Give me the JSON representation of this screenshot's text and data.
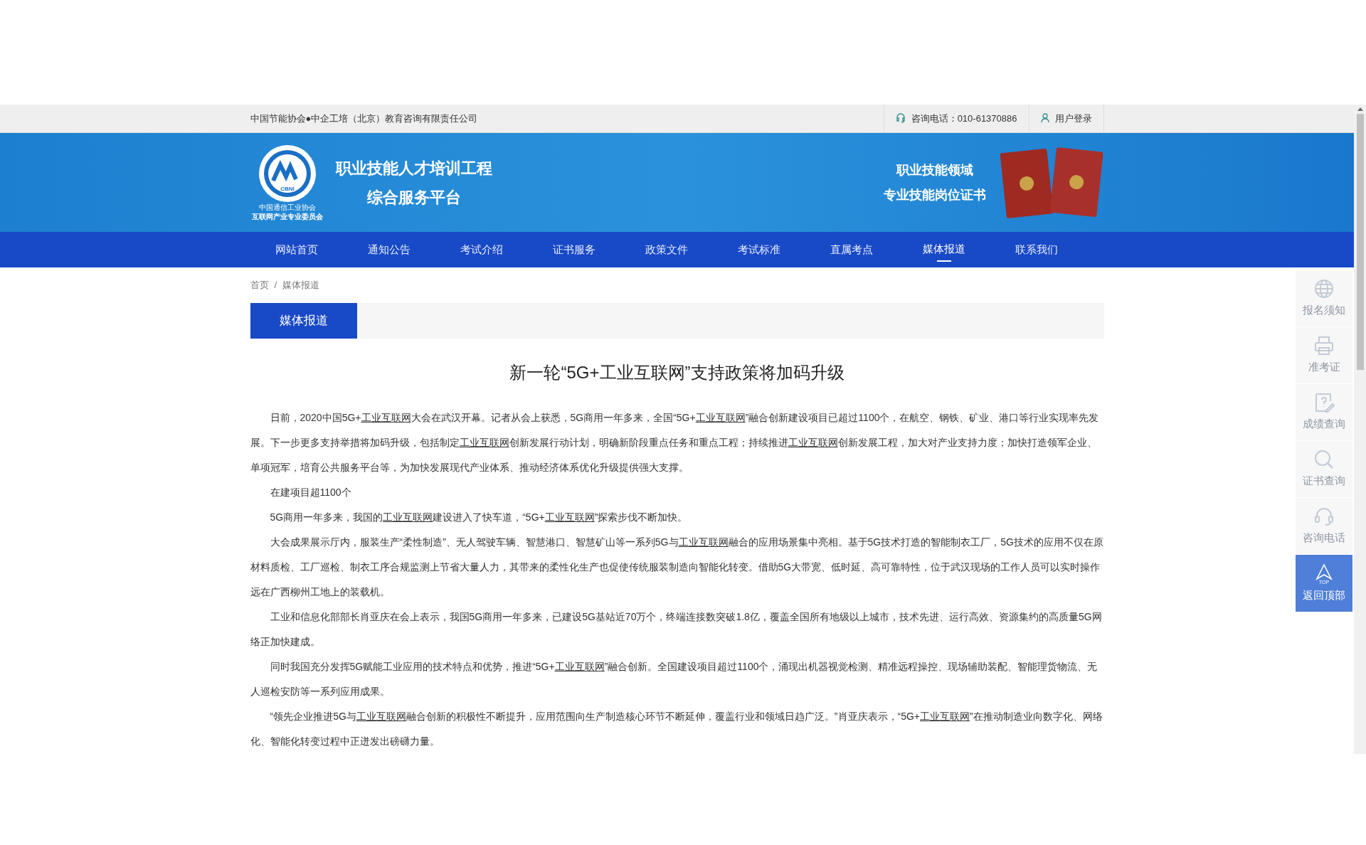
{
  "top_bar": {
    "organization": "中国节能协会●中企工培（北京）教育咨询有限责任公司",
    "phone": "咨询电话：010-61370886",
    "login": "用户登录"
  },
  "banner": {
    "logo_mark": "CBNI",
    "logo_caption": [
      "中国通信工业协会",
      "互联网产业专业委员会"
    ],
    "title_lines": [
      "职业技能人才培训工程",
      "综合服务平台"
    ],
    "slogan_lines": [
      "职业技能领域",
      "专业技能岗位证书"
    ]
  },
  "nav": [
    {
      "label": "网站首页",
      "selected": false
    },
    {
      "label": "通知公告",
      "selected": false
    },
    {
      "label": "考试介绍",
      "selected": false
    },
    {
      "label": "证书服务",
      "selected": false
    },
    {
      "label": "政策文件",
      "selected": false
    },
    {
      "label": "考试标准",
      "selected": false
    },
    {
      "label": "直属考点",
      "selected": false
    },
    {
      "label": "媒体报道",
      "selected": true
    },
    {
      "label": "联系我们",
      "selected": false
    }
  ],
  "breadcrumb": [
    "首页",
    "媒体报道"
  ],
  "breadcrumb_separator": "/",
  "section_tab": "媒体报道",
  "article": {
    "title": "新一轮“5G+工业互联网”支持政策将加码升级",
    "paragraphs": [
      [
        {
          "text": "日前，2020中国5G+"
        },
        {
          "text": "工业互联网",
          "link": true
        },
        {
          "text": "大会在武汉开幕。记者从会上获悉，5G商用一年多来，全国“5G+"
        },
        {
          "text": "工业互联网",
          "link": true
        },
        {
          "text": "”融合创新建设项目已超过1100个，在航空、钢铁、矿业、港口等行业实现率先发展。下一步更多支持举措将加码升级，包括制定"
        },
        {
          "text": "工业互联网",
          "link": true
        },
        {
          "text": "创新发展行动计划，明确新阶段重点任务和重点工程；持续推进"
        },
        {
          "text": "工业互联网",
          "link": true
        },
        {
          "text": "创新发展工程，加大对产业支持力度；加快打造领军企业、单项冠军，培育公共服务平台等，为加快发展现代产业体系、推动经济体系优化升级提供强大支撑。"
        }
      ],
      [
        {
          "text": "在建项目超1100个"
        }
      ],
      [
        {
          "text": "5G商用一年多来，我国的"
        },
        {
          "text": "工业互联网",
          "link": true
        },
        {
          "text": "建设进入了快车道，“5G+"
        },
        {
          "text": "工业互联网",
          "link": true
        },
        {
          "text": "”探索步伐不断加快。"
        }
      ],
      [
        {
          "text": "大会成果展示厅内，服装生产“柔性制造”、无人驾驶车辆、智慧港口、智慧矿山等一系列5G与"
        },
        {
          "text": "工业互联网",
          "link": true
        },
        {
          "text": "融合的应用场景集中亮相。基于5G技术打造的智能制衣工厂，5G技术的应用不仅在原材料质检、工厂巡检、制衣工序合规监测上节省大量人力，其带来的柔性化生产也促使传统服装制造向智能化转变。借助5G大带宽、低时延、高可靠特性，位于武汉现场的工作人员可以实时操作远在广西柳州工地上的装载机。"
        }
      ],
      [
        {
          "text": "工业和信息化部部长肖亚庆在会上表示，我国5G商用一年多来，已建设5G基站近70万个，终端连接数突破1.8亿，覆盖全国所有地级以上城市，技术先进、运行高效、资源集约的高质量5G网络正加快建成。"
        }
      ],
      [
        {
          "text": "同时我国充分发挥5G赋能工业应用的技术特点和优势，推进“5G+"
        },
        {
          "text": "工业互联网",
          "link": true
        },
        {
          "text": "”融合创新。全国建设项目超过1100个，涌现出机器视觉检测、精准远程操控、现场辅助装配、智能理货物流、无人巡检安防等一系列应用成果。"
        }
      ],
      [
        {
          "text": "“领先企业推进5G与"
        },
        {
          "text": "工业互联网",
          "link": true
        },
        {
          "text": "融合创新的积极性不断提升，应用范围向生产制造核心环节不断延伸，覆盖行业和领域日趋广泛。”肖亚庆表示，“5G+"
        },
        {
          "text": "工业互联网",
          "link": true
        },
        {
          "text": "”在推动制造业向数字化、网络化、智能化转变过程中正迸发出磅礴力量。"
        }
      ]
    ]
  },
  "side_menu": [
    {
      "label": "报名须知",
      "kind": "link"
    },
    {
      "label": "准考证",
      "kind": "link"
    },
    {
      "label": "成绩查询",
      "kind": "link"
    },
    {
      "label": "证书查询",
      "kind": "link"
    },
    {
      "label": "咨询电话",
      "kind": "link"
    },
    {
      "label": "返回顶部",
      "kind": "top",
      "badge": "TOP"
    }
  ]
}
